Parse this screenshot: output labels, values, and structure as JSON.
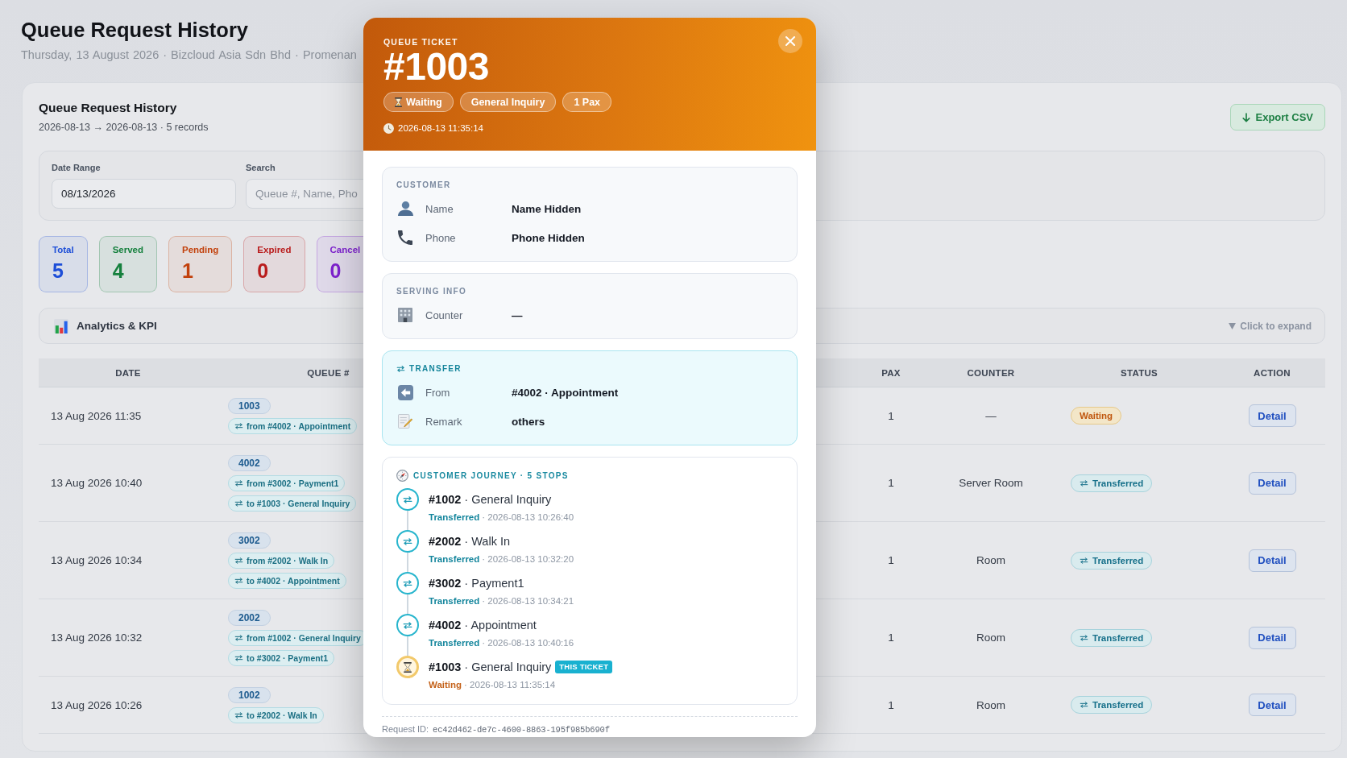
{
  "page": {
    "title": "Queue Request History",
    "subtitle": "Thursday, 13 August 2026 · Bizcloud Asia Sdn Bhd · Promenan"
  },
  "card": {
    "title": "Queue Request History",
    "subtitle": "2026-08-13 → 2026-08-13 · 5 records",
    "export_button": "Export CSV"
  },
  "filters": [
    {
      "label": "Date Range",
      "value": "08/13/2026"
    },
    {
      "label": "Search",
      "placeholder": "Queue #, Name, Pho"
    }
  ],
  "stats": [
    {
      "label": "Total",
      "value": "5",
      "color": "#1d4ed8"
    },
    {
      "label": "Served",
      "value": "4",
      "color": "#15803d"
    },
    {
      "label": "Pending",
      "value": "1",
      "color": "#c2410c"
    },
    {
      "label": "Expired",
      "value": "0",
      "color": "#b91c1c"
    },
    {
      "label": "Cancel",
      "value": "0",
      "color": "#7e22ce"
    }
  ],
  "analytics": {
    "title": "Analytics & KPI",
    "hint": "Click to expand"
  },
  "table": {
    "columns": [
      "DATE",
      "QUEUE #",
      "PAX",
      "COUNTER",
      "STATUS",
      "ACTION"
    ],
    "rows": [
      {
        "date": "13 Aug 2026 11:35",
        "queue": "1003",
        "transfers": [
          "from #4002 · Appointment"
        ],
        "pax": "1",
        "counter": "—",
        "status": {
          "label": "Waiting",
          "kind": "waiting"
        },
        "action": "Detail"
      },
      {
        "date": "13 Aug 2026 10:40",
        "queue": "4002",
        "transfers": [
          "from #3002 · Payment1",
          "to #1003 · General Inquiry"
        ],
        "pax": "1",
        "counter": "Server Room",
        "status": {
          "label": "Transferred",
          "kind": "transferred"
        },
        "action": "Detail"
      },
      {
        "date": "13 Aug 2026 10:34",
        "queue": "3002",
        "transfers": [
          "from #2002 · Walk In",
          "to #4002 · Appointment"
        ],
        "pax": "1",
        "counter": "Room",
        "status": {
          "label": "Transferred",
          "kind": "transferred"
        },
        "action": "Detail"
      },
      {
        "date": "13 Aug 2026 10:32",
        "queue": "2002",
        "transfers": [
          "from #1002 · General Inquiry",
          "to #3002 · Payment1"
        ],
        "pax": "1",
        "counter": "Room",
        "status": {
          "label": "Transferred",
          "kind": "transferred"
        },
        "action": "Detail"
      },
      {
        "date": "13 Aug 2026 10:26",
        "queue": "1002",
        "transfers": [
          "to #2002 · Walk In"
        ],
        "pax": "1",
        "counter": "Room",
        "status": {
          "label": "Transferred",
          "kind": "transferred"
        },
        "action": "Detail"
      }
    ]
  },
  "modal": {
    "eyebrow": "QUEUE TICKET",
    "number": "#1003",
    "chips": [
      {
        "label": "Waiting",
        "kind": "status"
      },
      {
        "label": "General Inquiry",
        "kind": "service"
      },
      {
        "label": "1 Pax",
        "kind": "pax"
      }
    ],
    "created": "2026-08-13 11:35:14",
    "sections": [
      {
        "kind": "plain",
        "title": "CUSTOMER",
        "rows": [
          {
            "kind": "name",
            "label": "Name",
            "value": "Name Hidden"
          },
          {
            "kind": "phone",
            "label": "Phone",
            "value": "Phone Hidden"
          }
        ]
      },
      {
        "kind": "plain",
        "title": "SERVING INFO",
        "rows": [
          {
            "kind": "counter",
            "label": "Counter",
            "value": "—"
          }
        ]
      },
      {
        "kind": "transfer",
        "title": "TRANSFER",
        "rows": [
          {
            "kind": "from",
            "label": "From",
            "value": "#4002 · Appointment"
          },
          {
            "kind": "remark",
            "label": "Remark",
            "value": "others"
          }
        ]
      }
    ],
    "journey": {
      "title": "CUSTOMER JOURNEY · 5 STOPS",
      "stops": [
        {
          "title": "**#1002** · General Inquiry",
          "status": "Transferred",
          "time": "· 2026-08-13 10:26:40",
          "kind": "transferred"
        },
        {
          "title": "**#2002** · Walk In",
          "status": "Transferred",
          "time": "· 2026-08-13 10:32:20",
          "kind": "transferred"
        },
        {
          "title": "**#3002** · Payment1",
          "status": "Transferred",
          "time": "· 2026-08-13 10:34:21",
          "kind": "transferred"
        },
        {
          "title": "**#4002** · Appointment",
          "status": "Transferred",
          "time": "· 2026-08-13 10:40:16",
          "kind": "transferred"
        },
        {
          "title": "**#1003** · General Inquiry",
          "badge": "THIS TICKET",
          "status": "Waiting",
          "time": "· 2026-08-13 11:35:14",
          "kind": "waiting"
        }
      ]
    },
    "footer": {
      "label": "Request ID:",
      "value": "ec42d462-de7c-4600-8863-195f985b690f"
    }
  }
}
